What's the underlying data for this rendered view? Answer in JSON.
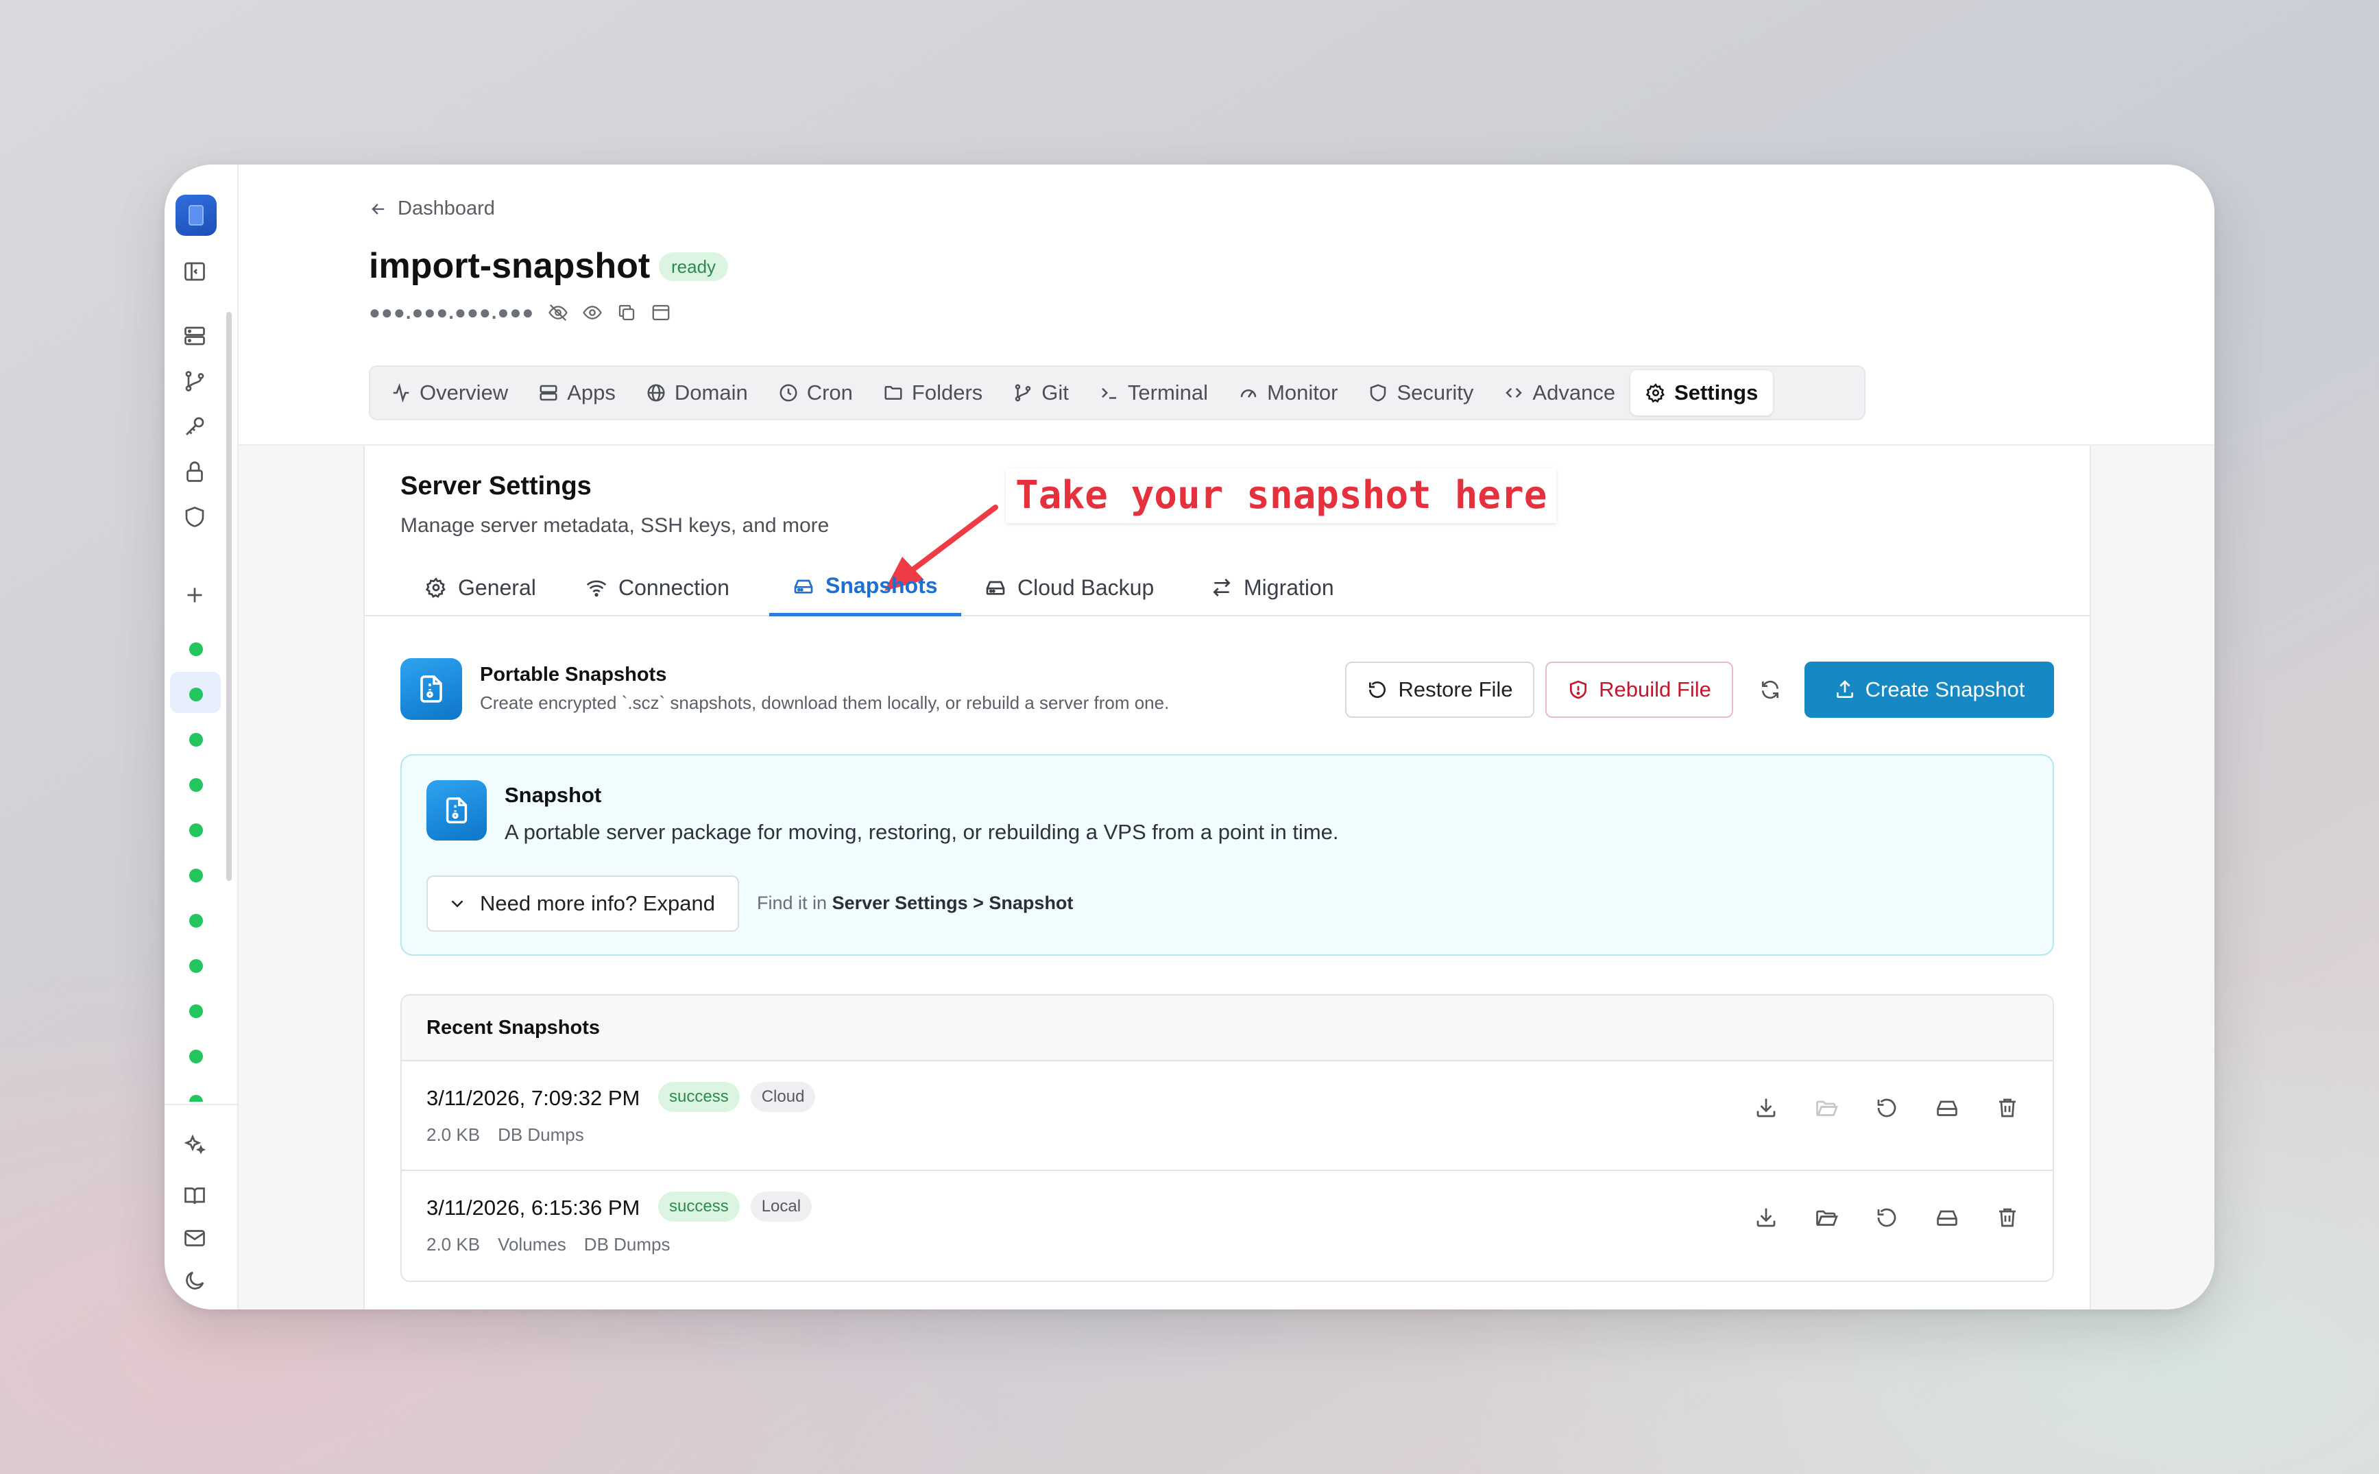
{
  "breadcrumb": "Dashboard",
  "server": {
    "name": "import-snapshot",
    "status": "ready",
    "ip_masked": "●●●.●●●.●●●.●●●"
  },
  "main_tabs": [
    {
      "label": "Overview",
      "icon": "activity-icon"
    },
    {
      "label": "Apps",
      "icon": "server-icon"
    },
    {
      "label": "Domain",
      "icon": "globe-icon"
    },
    {
      "label": "Cron",
      "icon": "clock-icon"
    },
    {
      "label": "Folders",
      "icon": "folder-icon"
    },
    {
      "label": "Git",
      "icon": "git-branch-icon"
    },
    {
      "label": "Terminal",
      "icon": "terminal-icon"
    },
    {
      "label": "Monitor",
      "icon": "gauge-icon"
    },
    {
      "label": "Security",
      "icon": "shield-icon"
    },
    {
      "label": "Advance",
      "icon": "code-icon"
    },
    {
      "label": "Settings",
      "icon": "gear-icon",
      "active": true
    }
  ],
  "settings": {
    "title": "Server Settings",
    "subtitle": "Manage server metadata, SSH keys, and more",
    "annotation": "Take your snapshot here",
    "tabs": [
      {
        "label": "General",
        "icon": "gear-icon"
      },
      {
        "label": "Connection",
        "icon": "wifi-icon"
      },
      {
        "label": "Snapshots",
        "icon": "hard-drive-icon",
        "active": true
      },
      {
        "label": "Cloud Backup",
        "icon": "hard-drive-icon"
      },
      {
        "label": "Migration",
        "icon": "swap-icon"
      }
    ]
  },
  "portable": {
    "title": "Portable Snapshots",
    "subtitle": "Create encrypted `.scz` snapshots, download them locally, or rebuild a server from one.",
    "restore_label": "Restore File",
    "rebuild_label": "Rebuild File",
    "create_label": "Create Snapshot"
  },
  "info": {
    "title": "Snapshot",
    "text": "A portable server package for moving, restoring, or rebuilding a VPS from a point in time.",
    "expand_label": "Need more info? Expand",
    "find_prefix": "Find it in",
    "find_path": "Server Settings > Snapshot"
  },
  "recent": {
    "title": "Recent Snapshots",
    "rows": [
      {
        "date": "3/11/2026, 7:09:32 PM",
        "status": "success",
        "location": "Cloud",
        "size": "2.0 KB",
        "tags": [
          "DB Dumps"
        ]
      },
      {
        "date": "3/11/2026, 6:15:36 PM",
        "status": "success",
        "location": "Local",
        "size": "2.0 KB",
        "tags": [
          "Volumes",
          "DB Dumps"
        ]
      }
    ]
  },
  "colors": {
    "accent": "#1689c4",
    "active_tab": "#1f6fd0",
    "status_dot": "#22c55e",
    "danger": "#c2172c",
    "annotation": "#e5303d"
  }
}
